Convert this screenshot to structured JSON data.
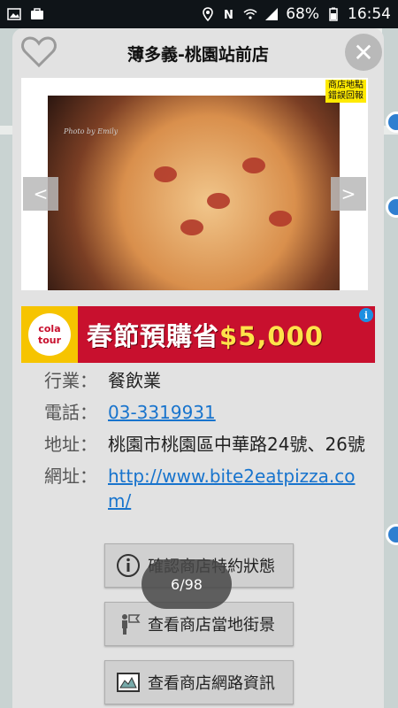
{
  "status_bar": {
    "battery": "68%",
    "time": "16:54"
  },
  "dialog": {
    "title": "薄多義-桃園站前店",
    "close_label": "✕",
    "favorite_icon": "heart-outline-icon"
  },
  "gallery": {
    "report_tag": "商店地點錯誤回報",
    "prev_label": "<",
    "next_label": ">",
    "photo_credit": "Photo by Emily"
  },
  "ad": {
    "logo_text": "cola tour",
    "headline": "春節預購省",
    "amount": "$5,000",
    "info_icon": "i"
  },
  "info": {
    "rows": [
      {
        "label": "行業：",
        "value": "餐飲業",
        "is_link": false
      },
      {
        "label": "電話：",
        "value": "03-3319931",
        "is_link": true
      },
      {
        "label": "地址：",
        "value": "桃園市桃園區中華路24號、26號",
        "is_link": false
      },
      {
        "label": "網址：",
        "value": "http://www.bite2eatpizza.com/",
        "is_link": true
      }
    ]
  },
  "actions": [
    {
      "label": "確認商店特約狀態",
      "icon": "info-circle-icon"
    },
    {
      "label": "查看商店當地街景",
      "icon": "street-view-icon"
    },
    {
      "label": "查看商店網路資訊",
      "icon": "map-icon"
    }
  ],
  "toast": "6/98",
  "colors": {
    "accent_link": "#1874cd",
    "ad_red": "#c8102e",
    "report_yellow": "#ffea00"
  }
}
